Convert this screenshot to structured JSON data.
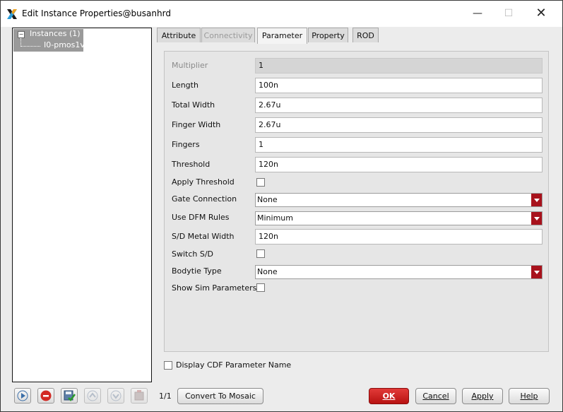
{
  "window": {
    "title": "Edit Instance Properties@busanhrd",
    "icon": "x-logo-icon",
    "controls": {
      "minimize": "—",
      "maximize": "☐",
      "close": "✕"
    }
  },
  "tree": {
    "root": "Instances (1)",
    "child": "I0-pmos1v",
    "expander": "−"
  },
  "tabs": [
    {
      "label": "Attribute",
      "state": "normal"
    },
    {
      "label": "Connectivity",
      "state": "disabled"
    },
    {
      "label": "Parameter",
      "state": "active"
    },
    {
      "label": "Property",
      "state": "normal"
    },
    {
      "label": "ROD",
      "state": "normal"
    }
  ],
  "params": {
    "multiplier": {
      "label": "Multiplier",
      "value": "1"
    },
    "length": {
      "label": "Length",
      "value": "100n"
    },
    "total_width": {
      "label": "Total Width",
      "value": "2.67u"
    },
    "finger_width": {
      "label": "Finger Width",
      "value": "2.67u"
    },
    "fingers": {
      "label": "Fingers",
      "value": "1"
    },
    "threshold": {
      "label": "Threshold",
      "value": "120n"
    },
    "apply_threshold": {
      "label": "Apply Threshold",
      "checked": false
    },
    "gate_connection": {
      "label": "Gate Connection",
      "value": "None"
    },
    "use_dfm_rules": {
      "label": "Use DFM Rules",
      "value": "Minimum"
    },
    "sd_metal_width": {
      "label": "S/D Metal Width",
      "value": "120n"
    },
    "switch_sd": {
      "label": "Switch S/D",
      "checked": false
    },
    "bodytie_type": {
      "label": "Bodytie Type",
      "value": "None"
    },
    "show_sim_parameters": {
      "label": "Show Sim Parameters",
      "checked": false
    }
  },
  "display_cdf": {
    "label": "Display CDF Parameter Name",
    "checked": false
  },
  "toolbar": {
    "icons": [
      "play-icon",
      "stop-icon",
      "save-check-icon",
      "up-icon",
      "down-icon",
      "delete-icon"
    ],
    "page": "1/1",
    "convert_label": "Convert To Mosaic"
  },
  "buttons": {
    "ok": "OK",
    "cancel": "Cancel",
    "apply": "Apply",
    "help": "Help"
  },
  "colors": {
    "ok_button": "#c9201f",
    "dropdown_arrow": "#a8121c",
    "tree_selection": "#9a9a9a"
  }
}
